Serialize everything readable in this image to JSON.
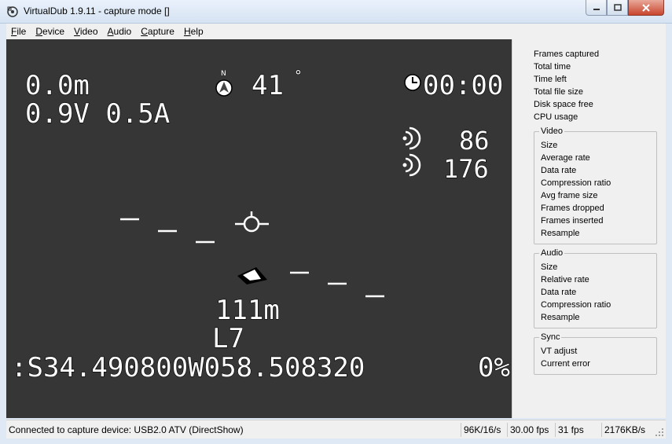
{
  "window": {
    "title": "VirtualDub 1.9.11 - capture mode []",
    "controls": {
      "minimize": "minimize-icon",
      "maximize": "maximize-icon",
      "close": "close-icon"
    }
  },
  "menu": {
    "items": [
      {
        "label": "File",
        "accel": "F",
        "rest": "ile"
      },
      {
        "label": "Device",
        "accel": "D",
        "rest": "evice"
      },
      {
        "label": "Video",
        "accel": "V",
        "rest": "ideo"
      },
      {
        "label": "Audio",
        "accel": "A",
        "rest": "udio"
      },
      {
        "label": "Capture",
        "accel": "C",
        "rest": "apture"
      },
      {
        "label": "Help",
        "accel": "H",
        "rest": "elp"
      }
    ]
  },
  "osd": {
    "altitude": "0.0m",
    "battery": "0.9V 0.5A",
    "heading_value": "41",
    "heading_degree": "°",
    "compass_letter": "N",
    "timer": "00:00",
    "rssi_1": "86",
    "rssi_2": "176",
    "distance": "111m",
    "line_label": "L7",
    "coordinates": ":S34.490800W058.508320",
    "right_edge": "0%"
  },
  "panel": {
    "top_items": [
      "Frames captured",
      "Total time",
      "Time left",
      "Total file size",
      "Disk space free",
      "CPU usage"
    ],
    "video": {
      "title": "Video",
      "items": [
        "Size",
        "Average rate",
        "Data rate",
        "Compression ratio",
        "Avg frame size",
        "Frames dropped",
        "Frames inserted",
        "Resample"
      ]
    },
    "audio": {
      "title": "Audio",
      "items": [
        "Size",
        "Relative rate",
        "Data rate",
        "Compression ratio",
        "Resample"
      ]
    },
    "sync": {
      "title": "Sync",
      "items": [
        "VT adjust",
        "Current error"
      ]
    }
  },
  "status": {
    "device": "Connected to capture device: USB2.0 ATV (DirectShow)",
    "audio_rate": "96K/16/s",
    "target_fps": "30.00 fps",
    "actual_fps": "31 fps",
    "data_rate": "2176KB/s"
  }
}
